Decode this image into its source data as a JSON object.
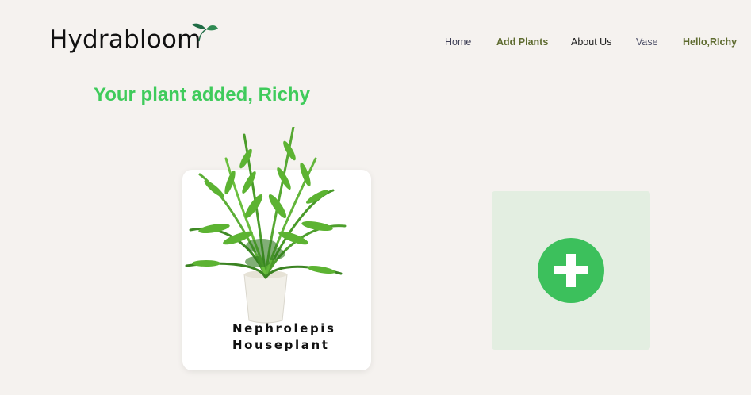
{
  "header": {
    "brand": "Hydrabloom",
    "brand_icon": "sprout-icon",
    "nav": {
      "home": "Home",
      "add_plants": "Add Plants",
      "about_us": "About Us",
      "vase": "Vase",
      "greeting": "Hello,RIchy"
    }
  },
  "main": {
    "heading": "Your plant added, Richy",
    "plant_card": {
      "name_line1": "Nephrolepis",
      "name_line2": "Houseplant",
      "image_icon": "fern-plant-image"
    },
    "add_card": {
      "icon": "plus-icon"
    }
  },
  "colors": {
    "background": "#f5f2ef",
    "heading_green": "#3fcb5b",
    "nav_active": "#5e6b2f",
    "add_card_bg": "#e3eee1",
    "add_button": "#3cc05c"
  }
}
